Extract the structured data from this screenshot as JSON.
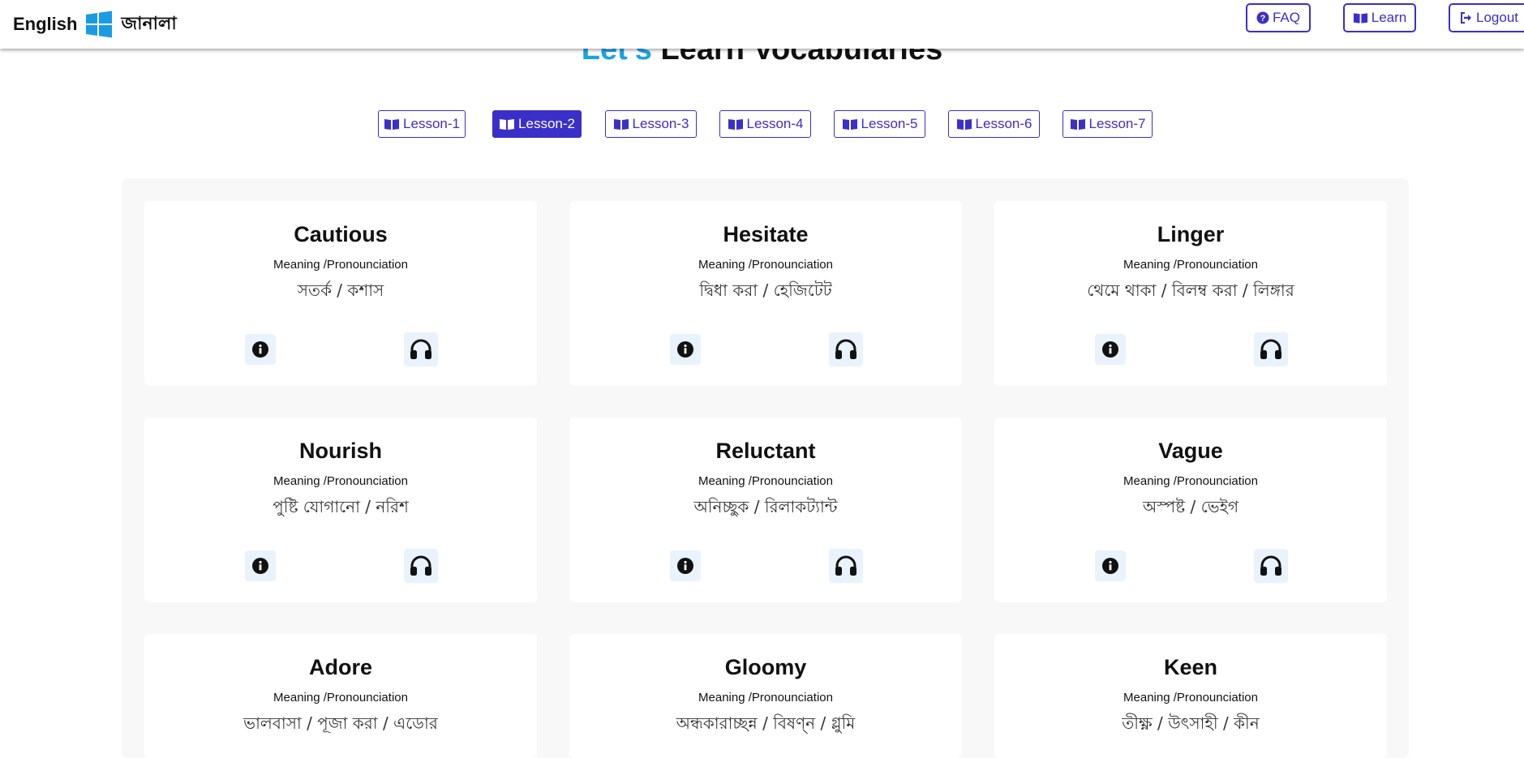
{
  "header": {
    "brand_en": "English",
    "brand_bn": "জানালা",
    "faq_label": "FAQ",
    "learn_label": "Learn",
    "logout_label": "Logout"
  },
  "heading": {
    "accent": "Let's",
    "main": "Learn Vocabularies"
  },
  "lessons": [
    {
      "label": "Lesson-1",
      "active": false
    },
    {
      "label": "Lesson-2",
      "active": true
    },
    {
      "label": "Lesson-3",
      "active": false
    },
    {
      "label": "Lesson-4",
      "active": false
    },
    {
      "label": "Lesson-5",
      "active": false
    },
    {
      "label": "Lesson-6",
      "active": false
    },
    {
      "label": "Lesson-7",
      "active": false
    }
  ],
  "cards": [
    {
      "word": "Cautious",
      "label": "Meaning /Pronounciation",
      "meaning": "সতর্ক / কশাস"
    },
    {
      "word": "Hesitate",
      "label": "Meaning /Pronounciation",
      "meaning": "দ্বিধা করা / হেজিটেট"
    },
    {
      "word": "Linger",
      "label": "Meaning /Pronounciation",
      "meaning": "থেমে থাকা / বিলম্ব করা / লিঙ্গার"
    },
    {
      "word": "Nourish",
      "label": "Meaning /Pronounciation",
      "meaning": "পুষ্টি যোগানো / নরিশ"
    },
    {
      "word": "Reluctant",
      "label": "Meaning /Pronounciation",
      "meaning": "অনিচ্ছুক / রিলাকট্যান্ট"
    },
    {
      "word": "Vague",
      "label": "Meaning /Pronounciation",
      "meaning": "অস্পষ্ট / ভেইগ"
    },
    {
      "word": "Adore",
      "label": "Meaning /Pronounciation",
      "meaning": "ভালবাসা / পূজা করা / এডোর"
    },
    {
      "word": "Gloomy",
      "label": "Meaning /Pronounciation",
      "meaning": "অন্ধকারাচ্ছন্ন / বিষণ্ন / গ্লুমি"
    },
    {
      "word": "Keen",
      "label": "Meaning /Pronounciation",
      "meaning": "তীক্ষ্ণ / উৎসাহী / কীন"
    }
  ],
  "colors": {
    "accent": "#3b2fc9",
    "heading_accent": "#1aa3e8",
    "icon_bg": "#e8f3fd",
    "panel_bg": "#f8f8f8"
  }
}
